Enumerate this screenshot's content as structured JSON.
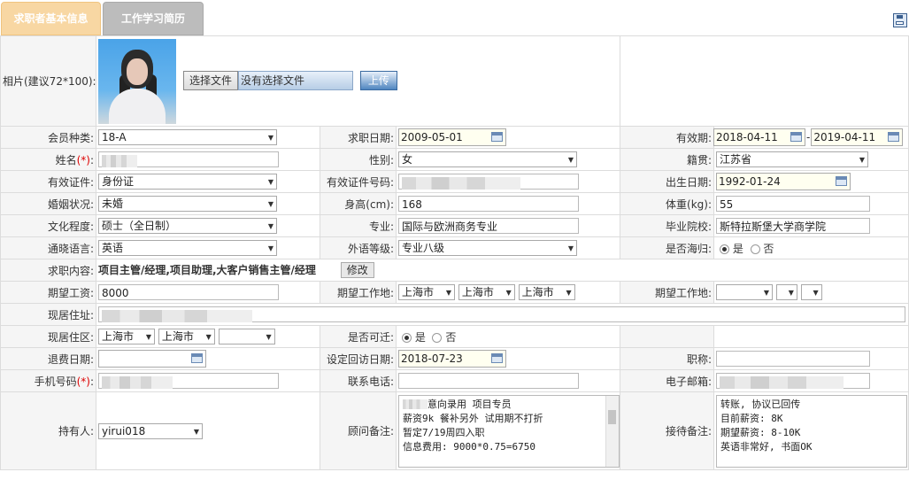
{
  "tabs": {
    "basic_info": "求职者基本信息",
    "history": "工作学习简历"
  },
  "photo": {
    "label": "相片(建议72*100):",
    "choose_btn": "选择文件",
    "no_file": "没有选择文件",
    "upload_btn": "上传"
  },
  "labels": {
    "member_type": "会员种类:",
    "apply_date": "求职日期:",
    "valid_period": "有效期:",
    "name": "姓名",
    "gender": "性别:",
    "hometown": "籍贯:",
    "id_type": "有效证件:",
    "id_number": "有效证件号码:",
    "birth_date": "出生日期:",
    "marital": "婚姻状况:",
    "height": "身高(cm):",
    "weight": "体重(kg):",
    "education": "文化程度:",
    "major": "专业:",
    "school": "毕业院校:",
    "language": "通晓语言:",
    "lang_level": "外语等级:",
    "overseas": "是否海归:",
    "job_content": "求职内容:",
    "salary": "期望工资:",
    "work_place1": "期望工作地:",
    "work_place2": "期望工作地:",
    "address": "现居住址:",
    "district": "现居住区:",
    "relocate": "是否可迁:",
    "refund_date": "退费日期:",
    "visit_date": "设定回访日期:",
    "title": "职称:",
    "mobile": "手机号码",
    "phone": "联系电话:",
    "email": "电子邮箱:",
    "holder": "持有人:",
    "consultant_note": "顾问备注:",
    "reception_note": "接待备注:",
    "required_mark": "(*)",
    "colon": ":",
    "dash": "-"
  },
  "values": {
    "member_type": "18-A",
    "apply_date": "2009-05-01",
    "valid_from": "2018-04-11",
    "valid_to": "2019-04-11",
    "gender": "女",
    "hometown": "江苏省",
    "id_type": "身份证",
    "birth_date": "1992-01-24",
    "marital": "未婚",
    "height": "168",
    "weight": "55",
    "education": "硕士（全日制）",
    "major": "国际与欧洲商务专业",
    "school": "斯特拉斯堡大学商学院",
    "language": "英语",
    "lang_level": "专业八级",
    "overseas_yes": "是",
    "overseas_no": "否",
    "job_content": "项目主管/经理,项目助理,大客户销售主管/经理",
    "edit_btn": "修改",
    "salary": "8000",
    "wp1_a": "上海市",
    "wp1_b": "上海市",
    "wp1_c": "上海市",
    "district_a": "上海市",
    "district_b": "上海市",
    "relocate_yes": "是",
    "relocate_no": "否",
    "visit_date": "2018-07-23",
    "holder": "yirui018",
    "consultant_note": "意向录用 项目专员\n薪资9k 餐补另外 试用期不打折\n暂定7/19周四入职\n信息费用: 9000*0.75=6750",
    "reception_note": "转账, 协议已回传\n目前薪资: 8K\n期望薪资: 8-10K\n英语非常好, 书面OK"
  }
}
